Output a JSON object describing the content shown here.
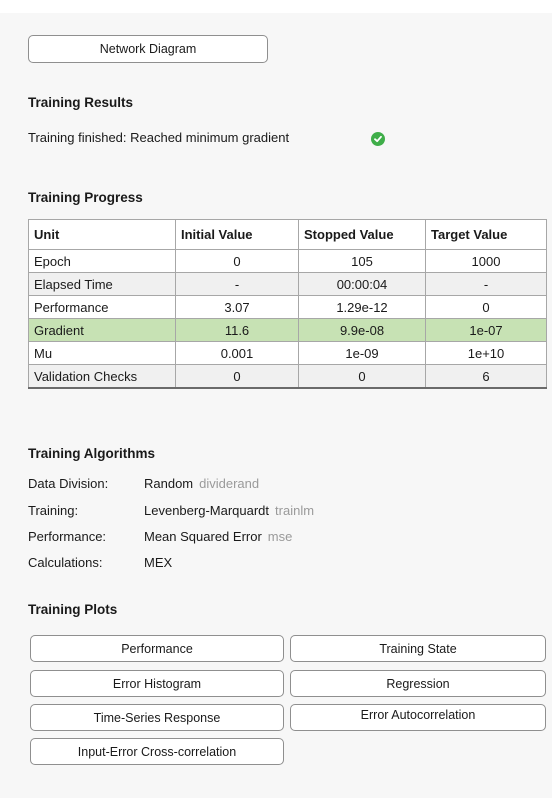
{
  "network_diagram_button": "Network Diagram",
  "results": {
    "heading": "Training Results",
    "status": "Training finished: Reached minimum gradient"
  },
  "progress": {
    "heading": "Training Progress",
    "columns": [
      "Unit",
      "Initial Value",
      "Stopped Value",
      "Target Value"
    ],
    "rows": [
      {
        "unit": "Epoch",
        "initial": "0",
        "stopped": "105",
        "target": "1000"
      },
      {
        "unit": "Elapsed Time",
        "initial": "-",
        "stopped": "00:00:04",
        "target": "-"
      },
      {
        "unit": "Performance",
        "initial": "3.07",
        "stopped": "1.29e-12",
        "target": "0"
      },
      {
        "unit": "Gradient",
        "initial": "11.6",
        "stopped": "9.9e-08",
        "target": "1e-07"
      },
      {
        "unit": "Mu",
        "initial": "0.001",
        "stopped": "1e-09",
        "target": "1e+10"
      },
      {
        "unit": "Validation Checks",
        "initial": "0",
        "stopped": "0",
        "target": "6"
      }
    ]
  },
  "algorithms": {
    "heading": "Training Algorithms",
    "items": [
      {
        "label": "Data Division:",
        "value": "Random",
        "fn": "dividerand"
      },
      {
        "label": "Training:",
        "value": "Levenberg-Marquardt",
        "fn": "trainlm"
      },
      {
        "label": "Performance:",
        "value": "Mean Squared Error",
        "fn": "mse"
      },
      {
        "label": "Calculations:",
        "value": "MEX",
        "fn": ""
      }
    ]
  },
  "plots": {
    "heading": "Training Plots",
    "buttons": {
      "performance": "Performance",
      "training_state": "Training State",
      "error_histogram": "Error Histogram",
      "regression": "Regression",
      "time_series_response": "Time-Series Response",
      "error_autocorrelation": "Error Autocorrelation",
      "input_error_crosscorrelation": "Input-Error Cross-correlation"
    }
  },
  "colors": {
    "success": "#3fae49",
    "highlight_row": "#c7e2b4"
  }
}
